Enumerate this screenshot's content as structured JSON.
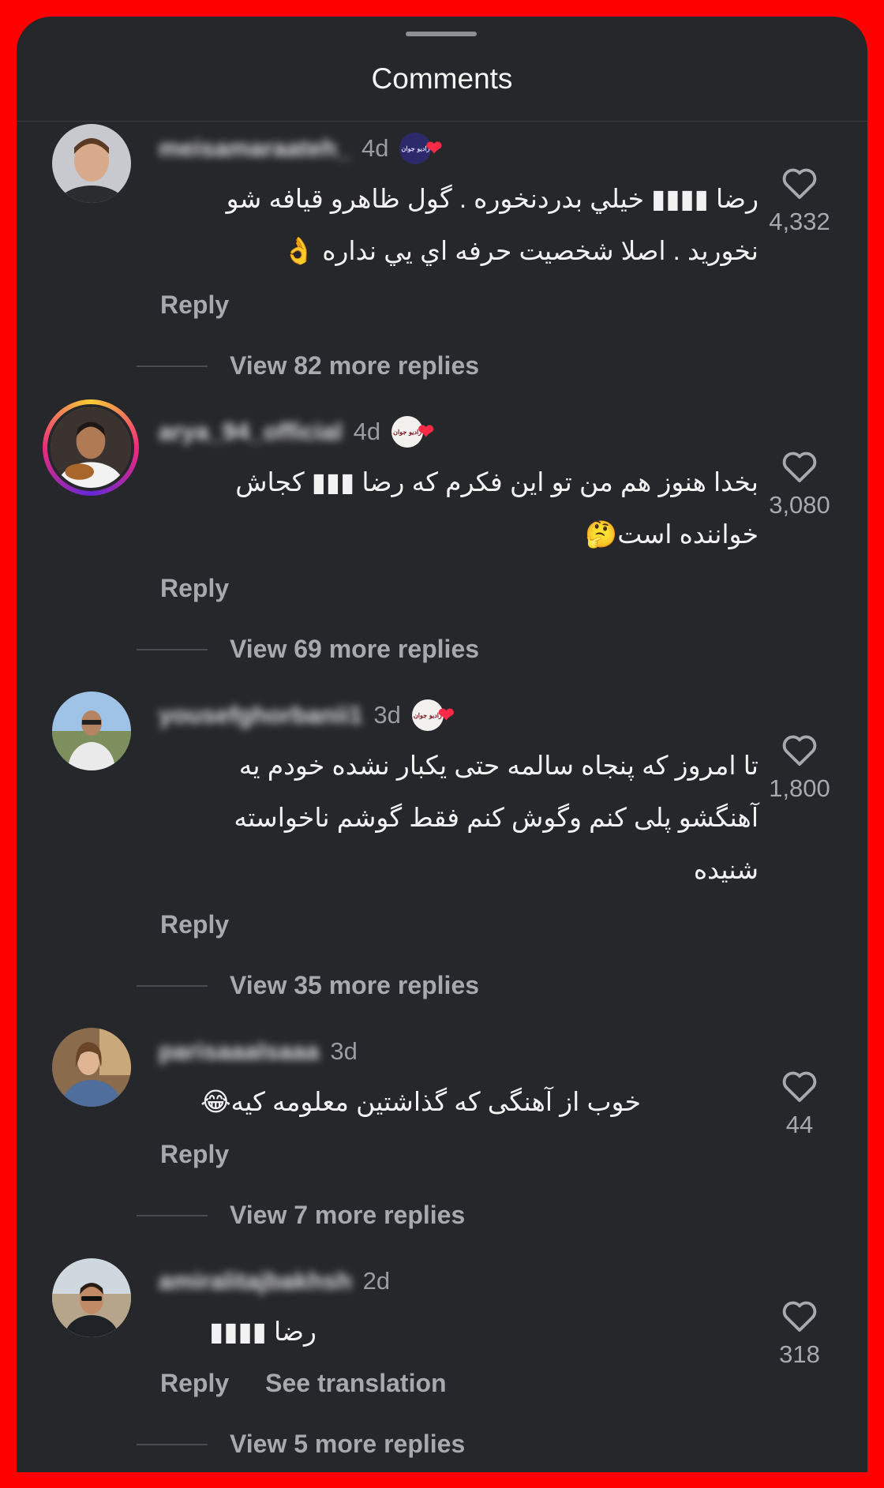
{
  "sheet": {
    "title": "Comments"
  },
  "comments": [
    {
      "username": "meisamaraateh_",
      "time": "4d",
      "badge": "رادیو جوان",
      "text_lines": [
        "رضا ▮▮▮▮ خيلي بدردنخوره . گول ظاهرو قيافه شو",
        "نخوريد . اصلا شخصيت حرفه اي يي نداره 👌"
      ],
      "reply": "Reply",
      "view_replies": "View 82 more replies",
      "likes": "4,332"
    },
    {
      "username": "arya_94_official",
      "time": "4d",
      "badge": "رادیو جوان",
      "text_lines": [
        "بخدا هنوز هم من تو اين فكرم كه رضا ▮▮▮ كجاش",
        "خواننده است🤔"
      ],
      "reply": "Reply",
      "view_replies": "View 69 more replies",
      "likes": "3,080"
    },
    {
      "username": "yousefghorbanii1",
      "time": "3d",
      "badge": "رادیو جوان",
      "text_lines": [
        "تا امروز که پنجاه سالمه حتی یکبار نشده خودم یه",
        "آهنگشو پلی کنم وگوش کنم فقط گوشم ناخواسته",
        "شنیده"
      ],
      "reply": "Reply",
      "view_replies": "View 35 more replies",
      "likes": "1,800"
    },
    {
      "username": "parisaaalsaaa",
      "time": "3d",
      "text_lines": [
        "خوب از آهنگی که گذاشتین معلومه کیه😂"
      ],
      "reply": "Reply",
      "view_replies": "View 7 more replies",
      "likes": "44"
    },
    {
      "username": "amiralitajbakhsh",
      "time": "2d",
      "text_lines": [
        "رضا ▮▮▮▮"
      ],
      "reply": "Reply",
      "see_translation": "See translation",
      "view_replies": "View 5 more replies",
      "likes": "318"
    }
  ],
  "icons": {
    "like": "heart-outline-icon"
  },
  "colors": {
    "frame": "#ff0000",
    "sheet": "#26272b",
    "text": "#f2f2f3",
    "muted": "#a7a9ae"
  }
}
